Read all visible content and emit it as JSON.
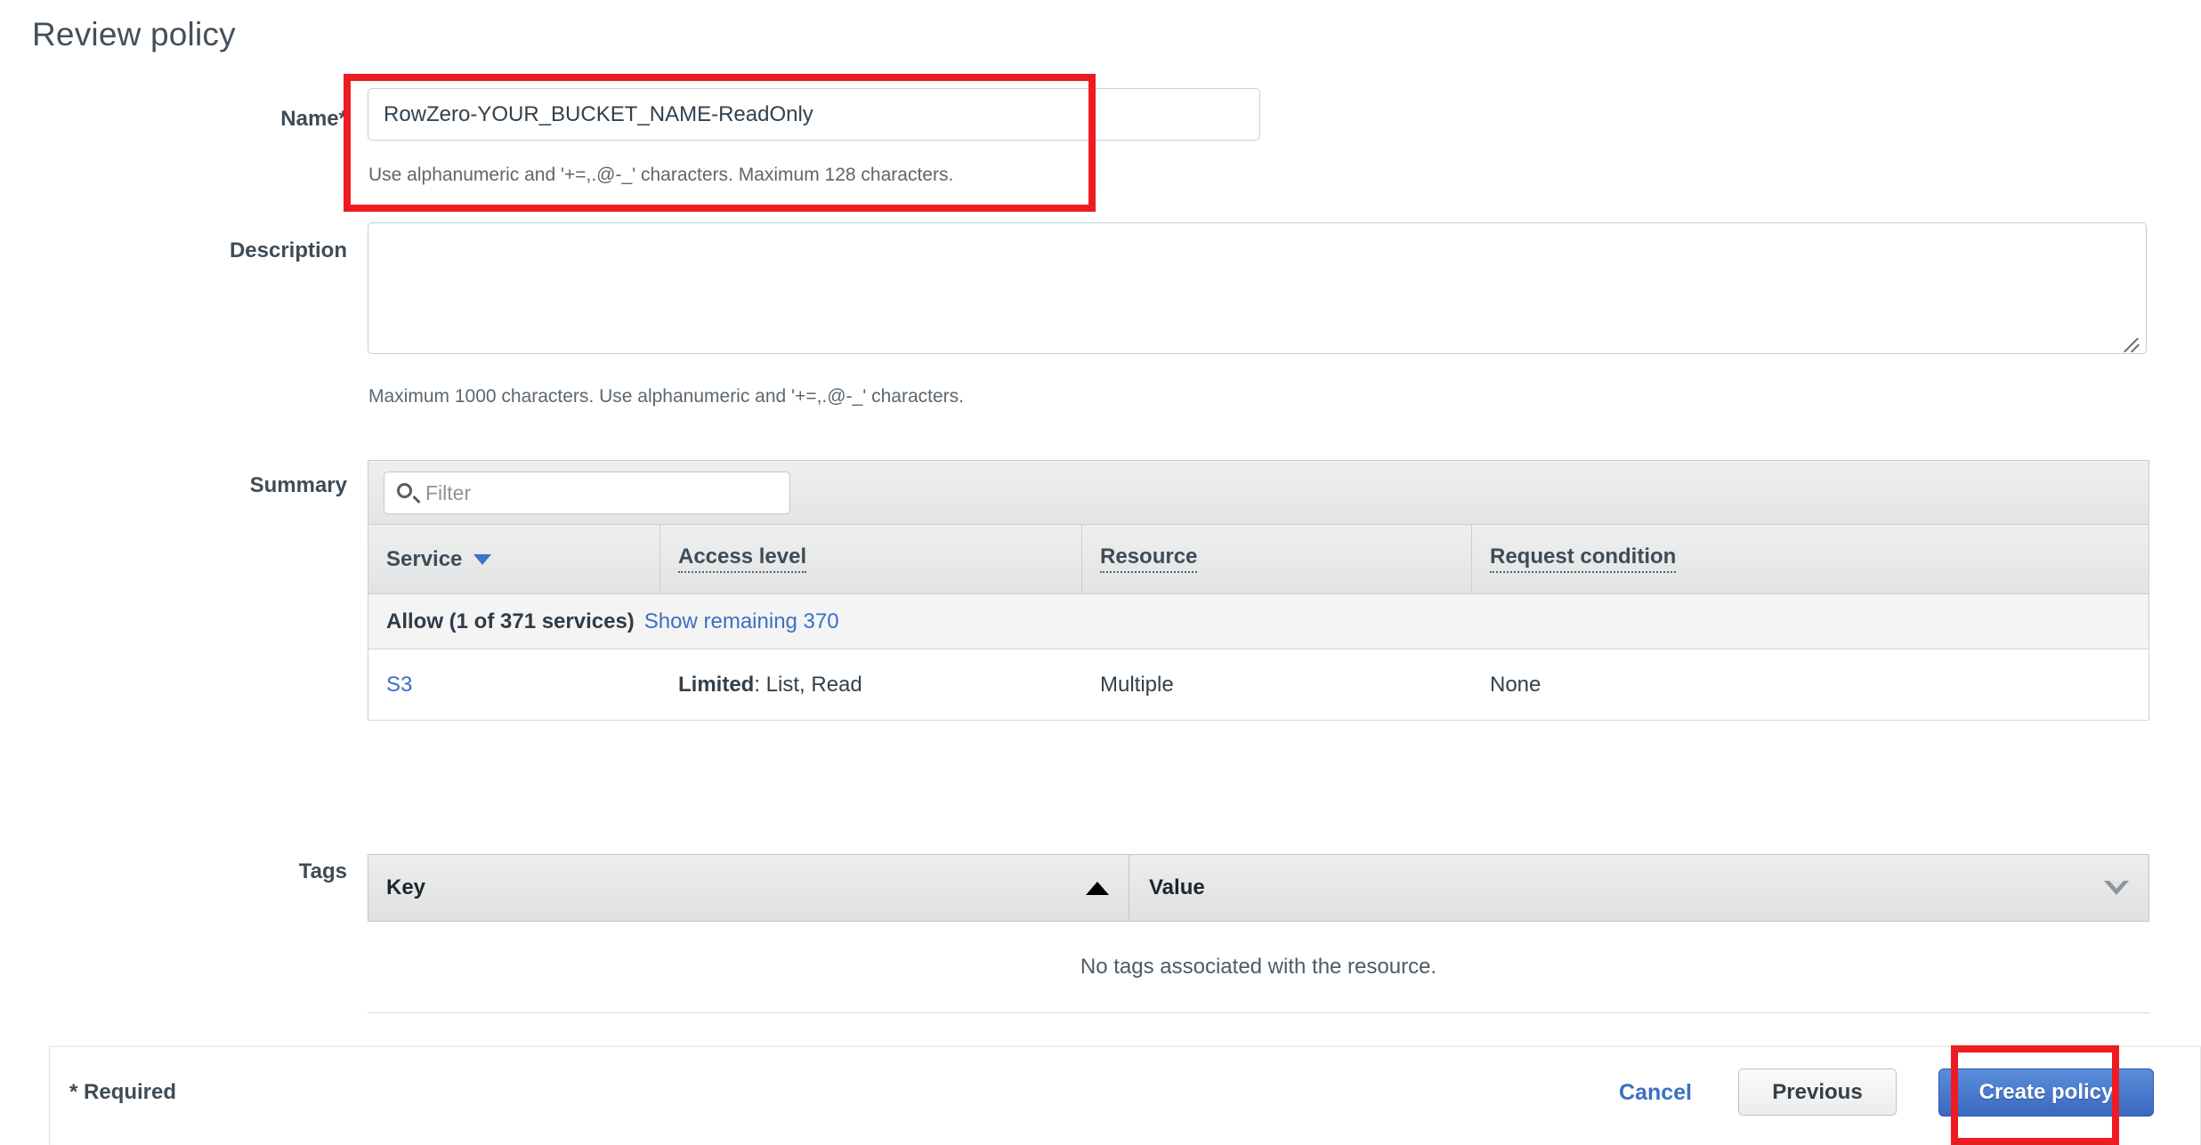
{
  "header": {
    "title": "Review policy"
  },
  "form": {
    "name": {
      "label": "Name*",
      "value": "RowZero-YOUR_BUCKET_NAME-ReadOnly",
      "placeholder": "",
      "hint": "Use alphanumeric and '+=,.@-_' characters. Maximum 128 characters."
    },
    "description": {
      "label": "Description",
      "value": "",
      "placeholder": "",
      "hint": "Maximum 1000 characters. Use alphanumeric and '+=,.@-_' characters."
    }
  },
  "summary": {
    "label": "Summary",
    "filter": {
      "placeholder": "Filter",
      "value": "",
      "icon": "search-icon"
    },
    "columns": [
      {
        "label": "Service",
        "sort_icon": "caret-down-icon"
      },
      {
        "label": "Access level",
        "tooltip": true
      },
      {
        "label": "Resource",
        "tooltip": true
      },
      {
        "label": "Request condition",
        "tooltip": true
      }
    ],
    "group_row": {
      "text": "Allow (1 of 371 services)",
      "link": "Show remaining 370"
    },
    "rows": [
      {
        "service": "S3",
        "access_level_prefix": "Limited",
        "access_level": ": List, Read",
        "resource": "Multiple",
        "request_condition": "None"
      }
    ]
  },
  "tags": {
    "label": "Tags",
    "columns": [
      {
        "label": "Key",
        "sort_icon": "triangle-up-icon"
      },
      {
        "label": "Value",
        "sort_icon": "triangle-down-icon"
      }
    ],
    "empty_message": "No tags associated with the resource."
  },
  "footer": {
    "required_note": "* Required",
    "cancel_label": "Cancel",
    "previous_label": "Previous",
    "create_label": "Create policy"
  },
  "colors": {
    "accent_blue": "#3b6fc4",
    "primary_button": "#3969c0",
    "annotation_red": "#ee1b22",
    "text_dark": "#3f4c56"
  }
}
